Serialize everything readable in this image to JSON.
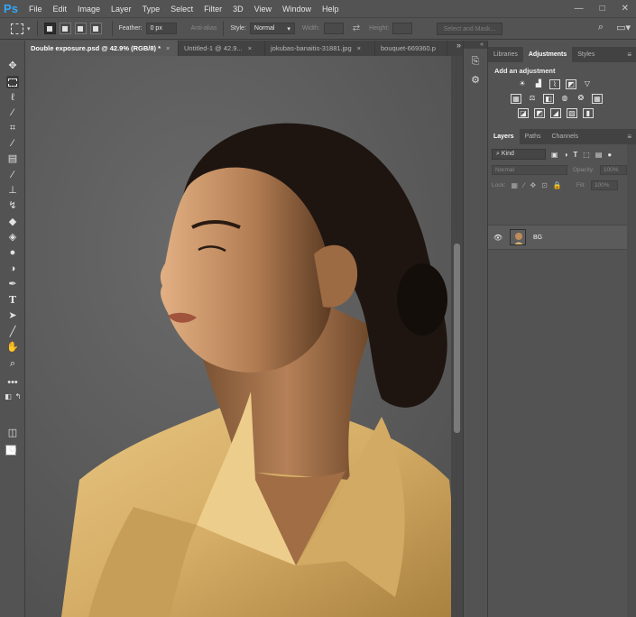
{
  "app": {
    "logo": "Ps"
  },
  "menu": [
    "File",
    "Edit",
    "Image",
    "Layer",
    "Type",
    "Select",
    "Filter",
    "3D",
    "View",
    "Window",
    "Help"
  ],
  "window_controls": {
    "minimize": "—",
    "maximize": "□",
    "close": "✕"
  },
  "options": {
    "feather_label": "Feather:",
    "feather_value": "0 px",
    "antialias_label": "Anti-alias",
    "style_label": "Style:",
    "style_value": "Normal",
    "width_label": "Width:",
    "height_label": "Height:",
    "select_mask": "Select and Mask..."
  },
  "tabs": [
    {
      "label": "Double exposure.psd @ 42.9% (RGB/8) *",
      "active": true
    },
    {
      "label": "Untitled-1 @ 42.9...",
      "active": false
    },
    {
      "label": "jokubas-banaitis-31881.jpg",
      "active": false
    },
    {
      "label": "bouquet-669360.p",
      "active": false
    }
  ],
  "tabs_more": "»",
  "adjustments_panel": {
    "tabs": [
      "Libraries",
      "Adjustments",
      "Styles"
    ],
    "active_tab": "Adjustments",
    "title": "Add an adjustment"
  },
  "layers_panel": {
    "tabs": [
      "Layers",
      "Paths",
      "Channels"
    ],
    "active_tab": "Layers",
    "kind_label": "Kind",
    "blend_mode": "Normal",
    "opacity_label": "Opacity:",
    "opacity_value": "100%",
    "lock_label": "Lock:",
    "fill_label": "Fill:",
    "fill_value": "100%",
    "layers": [
      {
        "name": "BG",
        "visible": true
      }
    ]
  },
  "colors": {
    "ui_bg": "#535353",
    "panel_dark": "#424242",
    "canvas_bg": "#5c5c5c",
    "ps_blue": "#31a8ff",
    "shirt": "#d9b46e",
    "skin": "#c08b5c",
    "hair": "#1e1510"
  }
}
